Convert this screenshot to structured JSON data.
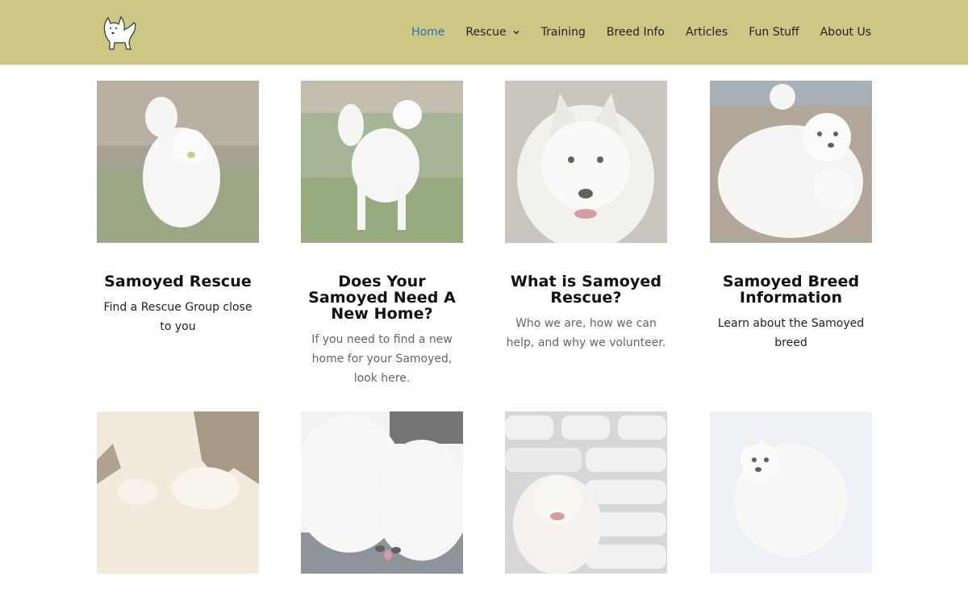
{
  "header": {
    "logo_icon": "samoyed-logo-icon",
    "nav": [
      {
        "label": "Home",
        "active": true
      },
      {
        "label": "Rescue",
        "dropdown": true
      },
      {
        "label": "Training"
      },
      {
        "label": "Breed Info"
      },
      {
        "label": "Articles"
      },
      {
        "label": "Fun Stuff"
      },
      {
        "label": "About Us"
      }
    ]
  },
  "cards": [
    {
      "title": "Samoyed Rescue",
      "desc": "Find a Rescue Group close to you",
      "image": "dog-running-photo"
    },
    {
      "title": "Does Your Samoyed Need A New Home?",
      "desc": "If you need to find a new home for your Samoyed, look here.",
      "image": "dog-standing-grass-photo"
    },
    {
      "title": "What is Samoyed Rescue?",
      "desc": "Who we are, how we can help, and why we volunteer.",
      "image": "dog-portrait-photo"
    },
    {
      "title": "Samoyed Breed Information",
      "desc": "Learn about the Samoyed breed",
      "image": "puppies-photo"
    },
    {
      "image": "dogs-in-snow-photo"
    },
    {
      "image": "dogs-sleeping-photo"
    },
    {
      "image": "dog-with-bark-bags-photo"
    },
    {
      "image": "dog-in-snow-photo"
    }
  ],
  "colors": {
    "header": "#cdc786",
    "active_nav": "#2d6bb5"
  }
}
